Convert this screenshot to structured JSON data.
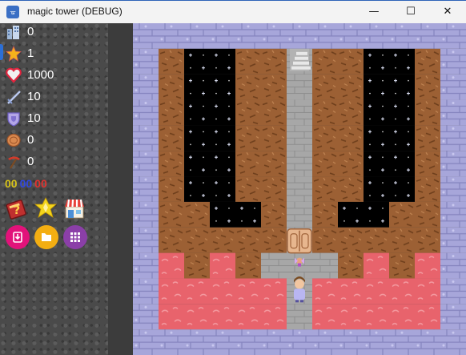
{
  "window": {
    "title": "magic tower (DEBUG)",
    "app_icon": "app-icon",
    "minimize_glyph": "—",
    "maximize_glyph": "☐",
    "close_glyph": "✕"
  },
  "stats": [
    {
      "icon": "floor-icon",
      "value": "0"
    },
    {
      "icon": "level-star-icon",
      "value": "1"
    },
    {
      "icon": "heart-icon",
      "value": "1000"
    },
    {
      "icon": "sword-icon",
      "value": "10"
    },
    {
      "icon": "shield-icon",
      "value": "10"
    },
    {
      "icon": "coin-icon",
      "value": "0"
    },
    {
      "icon": "pickaxe-icon",
      "value": "0"
    }
  ],
  "keys": {
    "yellow": "00",
    "blue": "00",
    "red": "00",
    "colors": {
      "yellow": "#d7c31a",
      "blue": "#2f47e0",
      "red": "#e0322e"
    }
  },
  "tools": [
    "monster-book-icon",
    "fly-star-icon",
    "shop-icon"
  ],
  "circle_buttons": [
    {
      "icon": "save-icon",
      "color": "#e2127a"
    },
    {
      "icon": "folder-icon",
      "color": "#f3ae12"
    },
    {
      "icon": "menu-grid-icon",
      "color": "#8b3fa8"
    }
  ],
  "map": {
    "legend": {
      "W": "stone-wall",
      "D": "dirt-ground",
      "S": "starry-void",
      "G": "gray-floor",
      "L": "lava"
    },
    "rows": [
      "WWWWWWWWWWWWW",
      "WDSSDDGDDSSDW",
      "WDSSDDGDDSSDW",
      "WDSSDDGDDSSDW",
      "WDSSDDGDDSSDW",
      "WDSSDDGDDSSDW",
      "WDSSDDGDDSSDW",
      "WDDSSDGDSSDDW",
      "WDDDDDGDDDDDW",
      "WLDLDGGGDLDLW",
      "WLLLLLGLLLLLW",
      "WLLLLLGLLLLLW",
      "WWWWWWWWWWWWW"
    ],
    "objects": [
      {
        "name": "upstairs",
        "row": 1,
        "col": 6
      },
      {
        "name": "door",
        "row": 8,
        "col": 6
      },
      {
        "name": "fairy-npc",
        "row": 9,
        "col": 6
      },
      {
        "name": "hero",
        "row": 10,
        "col": 6
      }
    ]
  }
}
